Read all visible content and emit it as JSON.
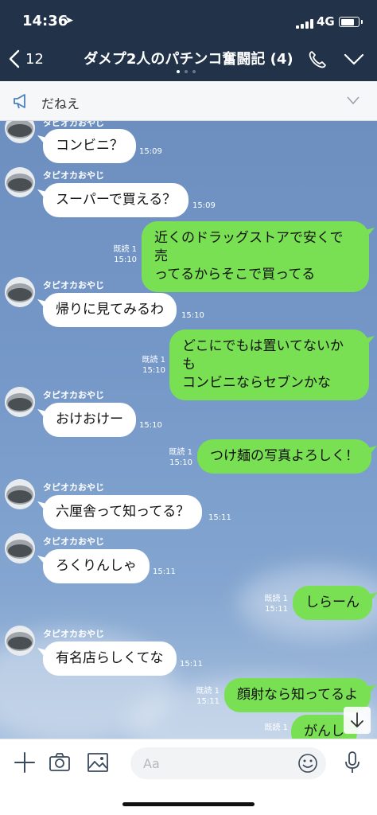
{
  "status_bar": {
    "time": "14:36",
    "network": "4G",
    "battery_level": 0.8
  },
  "header": {
    "back_count": "12",
    "title": "ダメプ2人のパチンコ奮闘記 (4)",
    "page_dots": 3,
    "active_dot": 0
  },
  "announcement": {
    "text": "だねえ"
  },
  "sender_name": "タピオカおやじ",
  "messages": [
    {
      "dir": "in",
      "text": "コンビニ？",
      "time": "15:09"
    },
    {
      "dir": "in",
      "text": "スーパーで買える？",
      "time": "15:09"
    },
    {
      "dir": "out",
      "text": "近くのドラッグストアで安くで売ってるからそこで買ってる",
      "line1": "近くのドラッグストアで安くで売",
      "line2": "ってるからそこで買ってる",
      "read": "既読 1",
      "time": "15:10"
    },
    {
      "dir": "in",
      "text": "帰りに見てみるわ",
      "time": "15:10"
    },
    {
      "dir": "out",
      "line1": "どこにでもは置いてないかも",
      "line2": "コンビニならセブンかな",
      "read": "既読 1",
      "time": "15:10"
    },
    {
      "dir": "in",
      "text": "おけおけー",
      "time": "15:10"
    },
    {
      "dir": "out",
      "text": "つけ麺の写真よろしく！",
      "read": "既読 1",
      "time": "15:10"
    },
    {
      "dir": "in",
      "text": "六厘舎って知ってる？",
      "time": "15:11"
    },
    {
      "dir": "in",
      "text": "ろくりんしゃ",
      "time": "15:11"
    },
    {
      "dir": "out",
      "text": "しらーん",
      "read": "既読 1",
      "time": "15:11"
    },
    {
      "dir": "in",
      "text": "有名店らしくてな",
      "time": "15:11"
    },
    {
      "dir": "out",
      "text": "顔射なら知ってるよ",
      "read": "既読 1",
      "time": "15:11"
    },
    {
      "dir": "out",
      "text": "がんし",
      "read": "既読 1",
      "time": ""
    }
  ],
  "input": {
    "placeholder": "Aa"
  },
  "colors": {
    "header_bg": "#213249",
    "out_bubble": "#7ae053",
    "in_bubble": "#ffffff",
    "chat_bg": "#7598c8"
  }
}
